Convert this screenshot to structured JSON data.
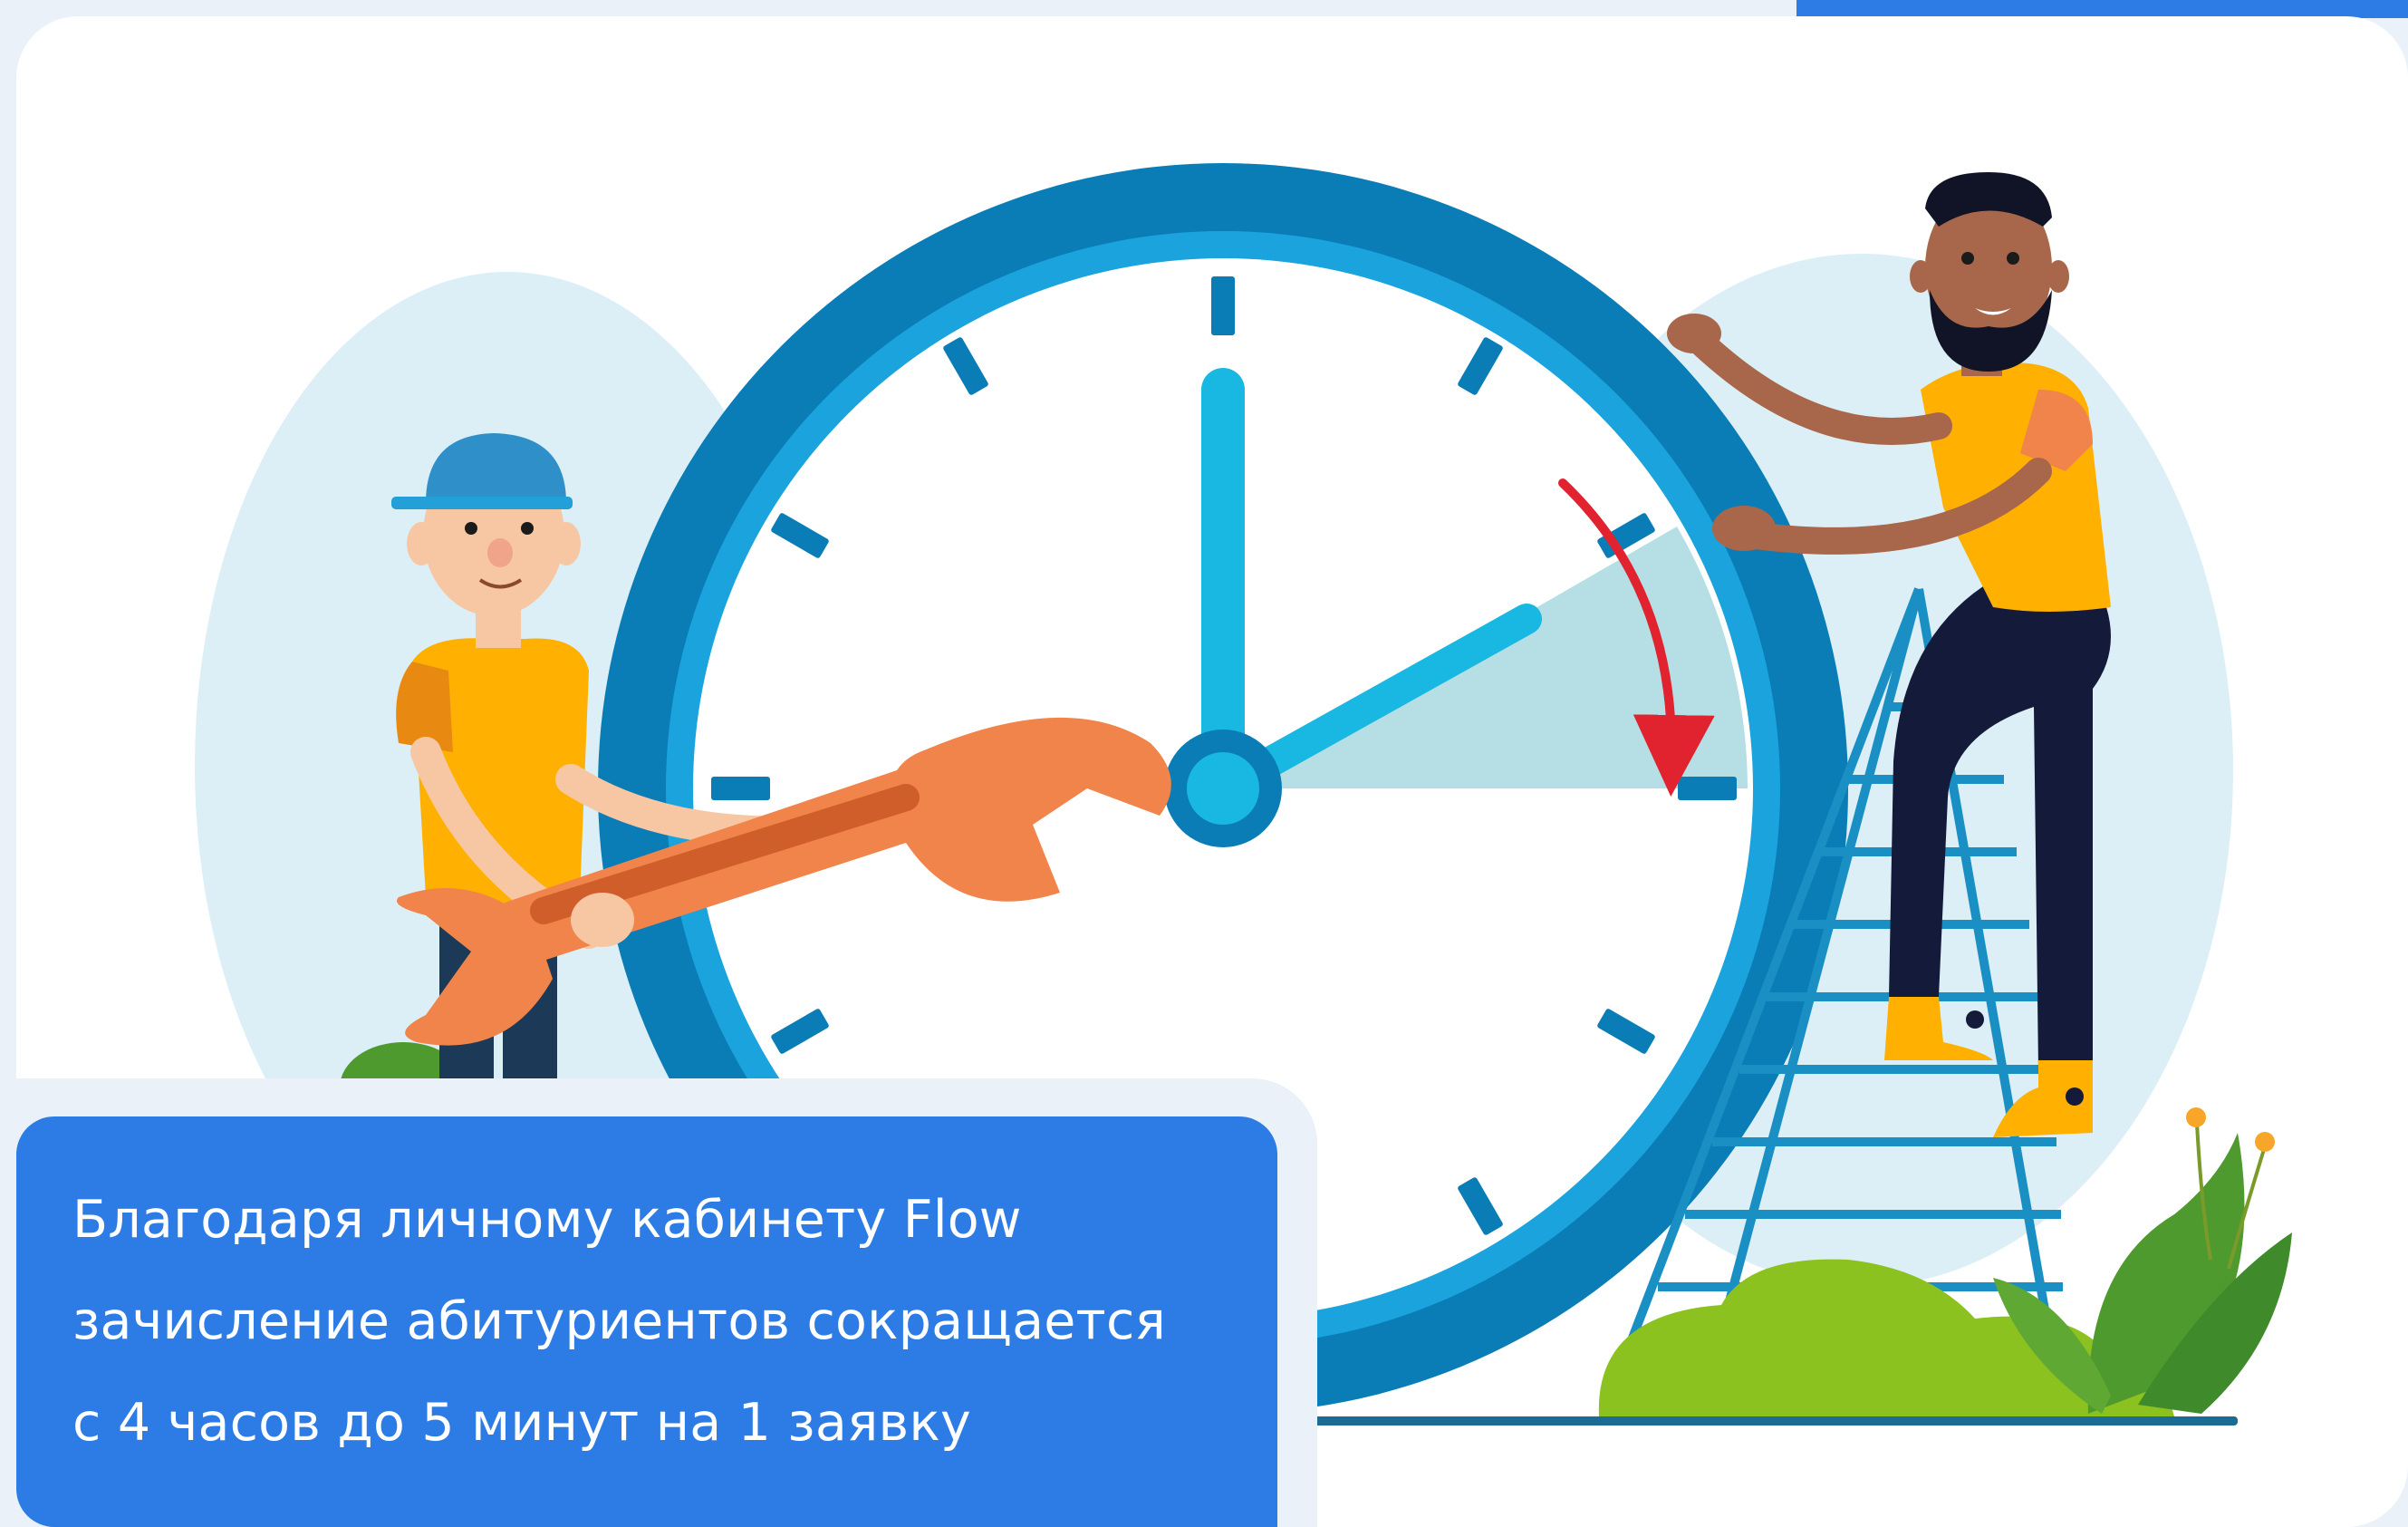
{
  "caption": {
    "lines": [
      "Благодаря личному кабинету Flow",
      "зачисление абитуриентов сокращается",
      "с 4 часов до 5 минут на 1 заявку"
    ]
  },
  "illustration": {
    "description_icon": "clock-repair-illustration",
    "colors": {
      "accent_blue": "#2d7be5",
      "clock_rim": "#0a7db7",
      "clock_hand": "#18b8e3",
      "arrow_red": "#e0232f",
      "wrench_orange": "#f0844a",
      "shirt_yellow": "#ffb000"
    }
  }
}
